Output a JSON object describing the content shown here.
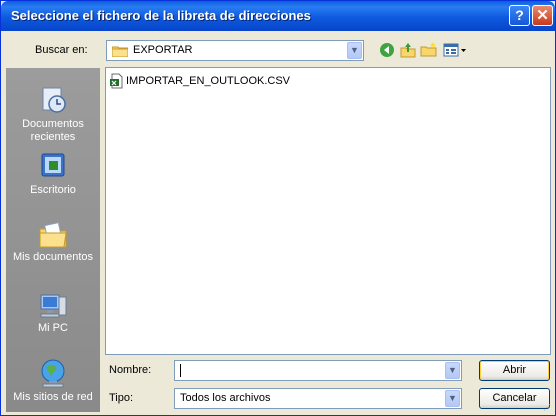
{
  "window": {
    "title": "Seleccione el fichero de la libreta de direcciones",
    "help_glyph": "?",
    "close_glyph": "✕"
  },
  "lookin": {
    "label": "Buscar en:",
    "value": "EXPORTAR",
    "icon": "folder-icon"
  },
  "toolbar": {
    "icons": [
      "back-icon",
      "up-folder-icon",
      "new-folder-icon",
      "view-menu-icon"
    ]
  },
  "places": [
    {
      "label": "Documentos\nrecientes",
      "icon": "recent-documents-icon"
    },
    {
      "label": "Escritorio",
      "icon": "desktop-icon"
    },
    {
      "label": "Mis documentos",
      "icon": "my-documents-icon"
    },
    {
      "label": "Mi PC",
      "icon": "my-computer-icon"
    },
    {
      "label": "Mis sitios de red",
      "icon": "network-places-icon"
    }
  ],
  "files": [
    {
      "name": "IMPORTAR_EN_OUTLOOK.CSV",
      "icon": "csv-file-icon"
    }
  ],
  "filename": {
    "label": "Nombre:",
    "value": ""
  },
  "filetype": {
    "label": "Tipo:",
    "value": "Todos los archivos"
  },
  "buttons": {
    "open": "Abrir",
    "cancel": "Cancelar"
  },
  "colors": {
    "titlebar": "#0a5ede",
    "dialog_bg": "#ece9d8",
    "places_bar": "#8e8e8e"
  }
}
